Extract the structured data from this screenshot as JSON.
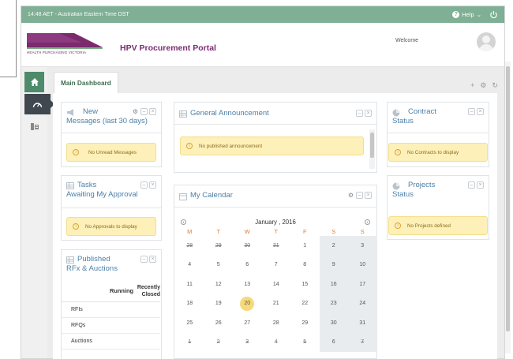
{
  "topbar": {
    "clock": "14:48 AET - Australian Eastern Time DST",
    "help_label": "Help",
    "help_caret": "⌄"
  },
  "header": {
    "logo_text": "HEALTH PURCHASING VICTORIA",
    "portal_title": "HPV Procurement Portal",
    "welcome": "Welcome"
  },
  "tabs": {
    "main": "Main Dashboard",
    "tools": [
      "+",
      "⚙",
      "↻"
    ]
  },
  "panels": {
    "new_messages": {
      "title": "New Messages (last 30 days)",
      "title_line1": "New",
      "title_line2": "Messages (last 30 days)",
      "alert": "No Unread Messages"
    },
    "tasks": {
      "title_line1": "Tasks",
      "title_line2": "Awaiting My Approval",
      "alert": "No Approvals to display"
    },
    "published": {
      "title_line1": "Published",
      "title_line2": "RFx & Auctions",
      "columns": [
        "",
        "Running",
        "Recently Closed"
      ],
      "col2_line1": "Recently",
      "col2_line2": "Closed",
      "rows": [
        "RFIs",
        "RFQs",
        "Auctions"
      ]
    },
    "announcement": {
      "title": "General Announcement",
      "alert": "No published announcement"
    },
    "calendar": {
      "title": "My Calendar",
      "month": "January , 2016",
      "days_of_week": [
        "M",
        "T",
        "W",
        "T",
        "F",
        "S",
        "S"
      ],
      "weeks": [
        [
          "28",
          "29",
          "30",
          "31",
          "1",
          "2",
          "3"
        ],
        [
          "4",
          "5",
          "6",
          "7",
          "8",
          "9",
          "10"
        ],
        [
          "11",
          "12",
          "13",
          "14",
          "15",
          "16",
          "17"
        ],
        [
          "18",
          "19",
          "20",
          "21",
          "22",
          "23",
          "24"
        ],
        [
          "25",
          "26",
          "27",
          "28",
          "29",
          "30",
          "31"
        ],
        [
          "1",
          "2",
          "3",
          "4",
          "5",
          "6",
          "7"
        ]
      ],
      "today": "20"
    },
    "contract": {
      "title_line1": "Contract",
      "title_line2": "Status",
      "alert": "No Contracts to display"
    },
    "projects": {
      "title_line1": "Projects",
      "title_line2": "Status",
      "alert": "No Projects defined"
    }
  },
  "colors": {
    "topbar": "#7faf94",
    "brand_purple": "#7b2b72",
    "panel_title_blue": "#4a7fa8",
    "alert_bg": "#fdf0b8",
    "weekday_header": "#e07a30"
  }
}
